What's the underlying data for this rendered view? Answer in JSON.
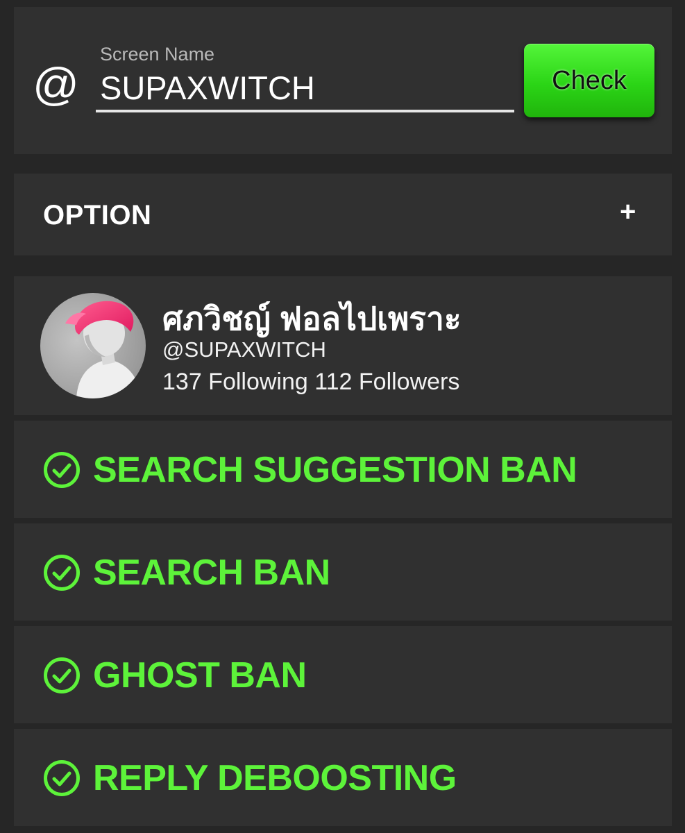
{
  "colors": {
    "background": "#262626",
    "panel": "#303030",
    "accent_green": "#5df33a",
    "button_green": "#2bd516"
  },
  "search": {
    "prefix": "@",
    "label": "Screen Name",
    "value": "SUPAXWITCH",
    "button_label": "Check"
  },
  "option": {
    "title": "OPTION",
    "toggle": "+"
  },
  "profile": {
    "display_name": "ศภวิชญ์ ฟอลไปเพราะ",
    "handle": "@SUPAXWITCH",
    "stats": "137 Following 112 Followers"
  },
  "results": [
    {
      "label": "SEARCH SUGGESTION BAN",
      "icon": "check-circle-icon"
    },
    {
      "label": "SEARCH BAN",
      "icon": "check-circle-icon"
    },
    {
      "label": "GHOST BAN",
      "icon": "check-circle-icon"
    },
    {
      "label": "REPLY DEBOOSTING",
      "icon": "check-circle-icon"
    }
  ]
}
